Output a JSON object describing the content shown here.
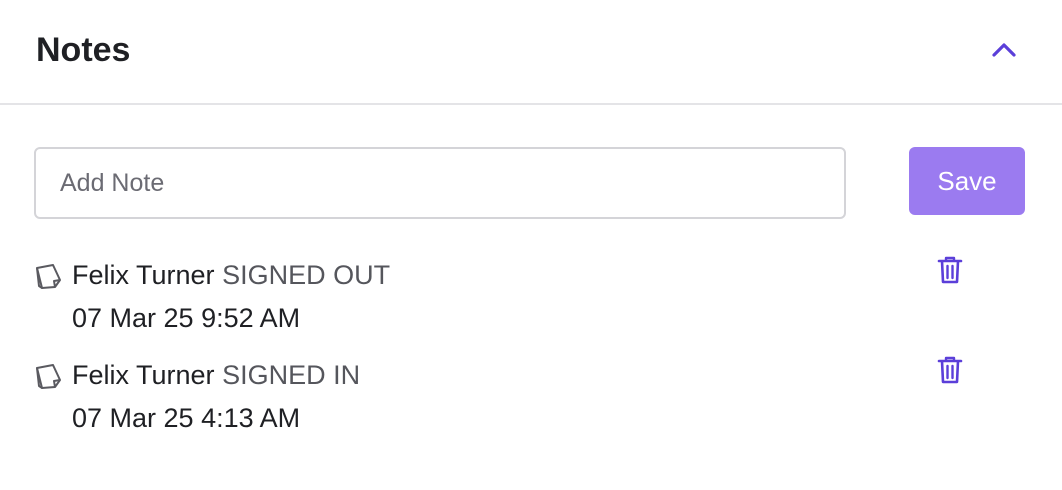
{
  "header": {
    "title": "Notes",
    "collapse_icon": "chevron-up-icon"
  },
  "composer": {
    "placeholder": "Add Note",
    "value": "",
    "save_label": "Save"
  },
  "notes": [
    {
      "author": "Felix Turner",
      "action": "SIGNED OUT",
      "timestamp": "07 Mar 25 9:52 AM",
      "icon": "note-icon",
      "delete_icon": "trash-icon"
    },
    {
      "author": "Felix Turner",
      "action": "SIGNED IN",
      "timestamp": "07 Mar 25 4:13 AM",
      "icon": "note-icon",
      "delete_icon": "trash-icon"
    }
  ],
  "colors": {
    "accent": "#5b3fd9",
    "save_button": "#9b7bf0",
    "divider": "#e4e4e7",
    "input_border": "#d4d4d8"
  }
}
